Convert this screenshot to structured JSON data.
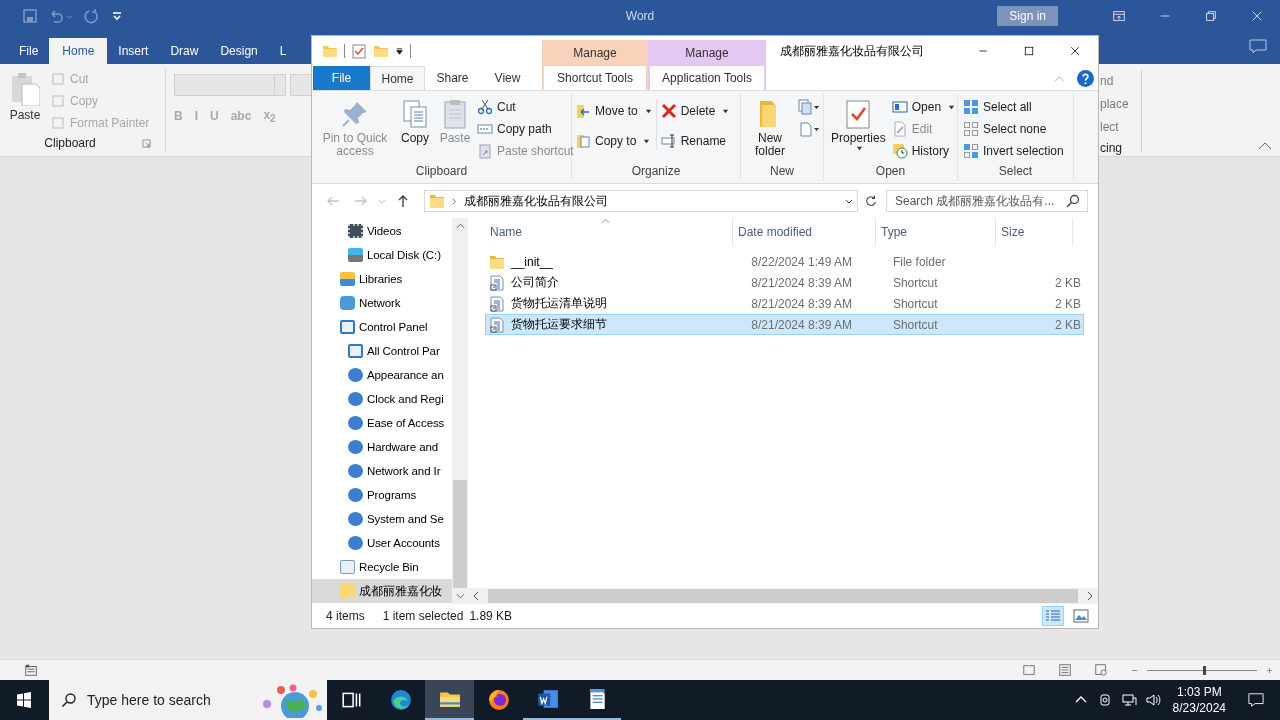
{
  "word": {
    "title": "Word",
    "sign_in": "Sign in",
    "tabs": [
      {
        "label": "File",
        "selected": false
      },
      {
        "label": "Home",
        "selected": true
      },
      {
        "label": "Insert",
        "selected": false
      },
      {
        "label": "Draw",
        "selected": false
      },
      {
        "label": "Design",
        "selected": false
      },
      {
        "label": "L",
        "selected": false
      }
    ],
    "clipboard": {
      "paste": "Paste",
      "group": "Clipboard",
      "items": [
        {
          "label": "Cut",
          "disabled": true
        },
        {
          "label": "Copy",
          "disabled": true
        },
        {
          "label": "Format Painter",
          "disabled": true
        }
      ]
    },
    "format_buttons": [
      "B",
      "I",
      "U",
      "abc",
      "x$_{2}$"
    ],
    "editing_fragments": [
      "nd",
      "place",
      "lect"
    ],
    "editing_group": "cing",
    "zoom": {
      "level": 0.52
    }
  },
  "explorer": {
    "title": "成都丽雅嘉化妆品有限公司",
    "context_tabs": [
      {
        "header": "Manage",
        "label": "Shortcut Tools",
        "color": "#f9d2bb",
        "selected": false
      },
      {
        "header": "Manage",
        "label": "Application Tools",
        "color": "#e3c8f2",
        "selected": false
      }
    ],
    "tabs": [
      {
        "label": "File",
        "kind": "file",
        "selected": false
      },
      {
        "label": "Home",
        "kind": "tab",
        "selected": true
      },
      {
        "label": "Share",
        "kind": "tab",
        "selected": false
      },
      {
        "label": "View",
        "kind": "tab",
        "selected": false
      }
    ],
    "ribbon": {
      "clipboard": {
        "label": "Clipboard",
        "pin": {
          "label": "Pin to Quick access",
          "disabled": true
        },
        "copy": {
          "label": "Copy",
          "disabled": false
        },
        "paste": {
          "label": "Paste",
          "disabled": true
        },
        "cut": {
          "label": "Cut",
          "disabled": false
        },
        "copy_path": {
          "label": "Copy path",
          "disabled": false
        },
        "paste_shortcut": {
          "label": "Paste shortcut",
          "disabled": true
        }
      },
      "organize": {
        "label": "Organize",
        "move_to": "Move to",
        "copy_to": "Copy to",
        "delete": "Delete",
        "rename": "Rename"
      },
      "new": {
        "label": "New",
        "new_folder": "New folder"
      },
      "open": {
        "label": "Open",
        "properties": "Properties",
        "open": {
          "label": "Open",
          "disabled": false
        },
        "edit": {
          "label": "Edit",
          "disabled": true
        },
        "history": {
          "label": "History",
          "disabled": false
        }
      },
      "select": {
        "label": "Select",
        "select_all": "Select all",
        "select_none": "Select none",
        "invert": "Invert selection"
      }
    },
    "address": {
      "path": "成都丽雅嘉化妆品有限公司"
    },
    "search": {
      "placeholder": "Search 成都丽雅嘉化妆品有..."
    },
    "nav_pane": {
      "upper_children": [
        {
          "label": "Videos",
          "kind": "videos",
          "selected": false
        },
        {
          "label": "Local Disk (C:)",
          "kind": "drive",
          "selected": false
        }
      ],
      "items": [
        {
          "label": "Libraries",
          "kind": "libraries",
          "selected": false
        },
        {
          "label": "Network",
          "kind": "network",
          "selected": false
        },
        {
          "label": "Control Panel",
          "kind": "control-panel",
          "selected": false,
          "children": [
            {
              "label": "All Control Par",
              "kind": "control-panel",
              "selected": false
            },
            {
              "label": "Appearance an",
              "kind": "applet",
              "selected": false
            },
            {
              "label": "Clock and Regi",
              "kind": "applet",
              "selected": false
            },
            {
              "label": "Ease of Access",
              "kind": "applet",
              "selected": false
            },
            {
              "label": "Hardware and",
              "kind": "applet",
              "selected": false
            },
            {
              "label": "Network and Ir",
              "kind": "applet",
              "selected": false
            },
            {
              "label": "Programs",
              "kind": "applet",
              "selected": false
            },
            {
              "label": "System and Se",
              "kind": "applet",
              "selected": false
            },
            {
              "label": "User Accounts",
              "kind": "applet",
              "selected": false
            }
          ]
        },
        {
          "label": "Recycle Bin",
          "kind": "recycle-bin",
          "selected": false
        },
        {
          "label": "成都丽雅嘉化妆",
          "kind": "folder",
          "selected": true
        }
      ]
    },
    "files": {
      "columns": [
        {
          "label": "Name",
          "sorted": true
        },
        {
          "label": "Date modified",
          "sorted": false
        },
        {
          "label": "Type",
          "sorted": false
        },
        {
          "label": "Size",
          "sorted": false
        }
      ],
      "rows": [
        {
          "kind": "folder",
          "name": "__init__",
          "date": "8/22/2024 1:49 AM",
          "type": "File folder",
          "selected": false
        },
        {
          "kind": "shortcut",
          "name": "公司简介",
          "date": "8/21/2024 8:39 AM",
          "type": "Shortcut",
          "size": "2 KB",
          "selected": false
        },
        {
          "kind": "shortcut",
          "name": "货物托运清单说明",
          "date": "8/21/2024 8:39 AM",
          "type": "Shortcut",
          "size": "2 KB",
          "selected": false
        },
        {
          "kind": "shortcut",
          "name": "货物托运要求细节",
          "date": "8/21/2024 8:39 AM",
          "type": "Shortcut",
          "size": "2 KB",
          "selected": true
        }
      ]
    },
    "status": {
      "count": "4 items",
      "selection": "1 item selected",
      "size": "1.89 KB",
      "views": [
        {
          "kind": "details",
          "selected": true
        },
        {
          "kind": "large-icons",
          "selected": false
        }
      ]
    }
  },
  "taskbar": {
    "search_placeholder": "Type here to search",
    "apps": [
      {
        "kind": "task-view",
        "running": false,
        "selected": false
      },
      {
        "kind": "edge",
        "running": false,
        "selected": false
      },
      {
        "kind": "explorer",
        "running": true,
        "selected": true
      },
      {
        "kind": "firefox",
        "running": false,
        "selected": false
      },
      {
        "kind": "word",
        "running": true,
        "selected": false
      },
      {
        "kind": "notepad",
        "running": true,
        "selected": false
      }
    ],
    "time": "1:03 PM",
    "date": "8/23/2024"
  }
}
